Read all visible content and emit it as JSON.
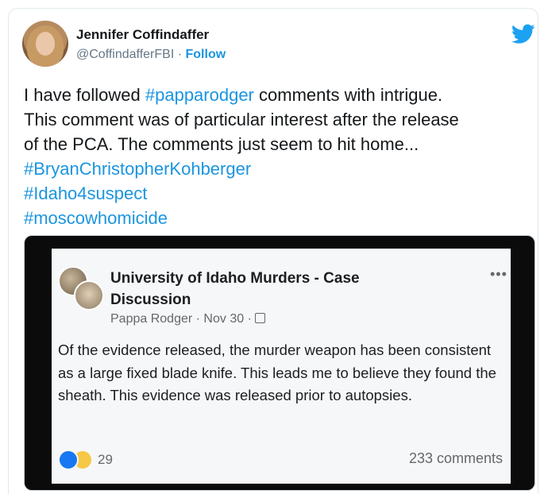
{
  "author": {
    "name": "Jennifer Coffindaffer",
    "handle": "@CoffindafferFBI",
    "separator": "·",
    "follow_label": "Follow"
  },
  "tweet": {
    "text_part1": "I have followed ",
    "hashtag1": "#papparodger",
    "text_part2": " comments with intrigue.",
    "line2": "This comment was of particular interest after the release",
    "line3": "of the PCA. The comments just seem to hit home...",
    "hashtag2": "#BryanChristopherKohberger",
    "hashtag3": "#Idaho4suspect",
    "hashtag4": "#moscowhomicide"
  },
  "embedded_post": {
    "group_title": "University of Idaho Murders - Case Discussion",
    "poster": "Pappa Rodger",
    "date": "Nov 30",
    "body": "Of the evidence released, the murder weapon has been consistent as a large fixed blade knife.  This leads me to believe they found the sheath.  This evidence was released prior to autopsies.",
    "reaction_count": "29",
    "comments": "233 comments"
  },
  "colors": {
    "link": "#1b95e0",
    "twitter_blue": "#1da1f2",
    "text": "#14171a"
  }
}
